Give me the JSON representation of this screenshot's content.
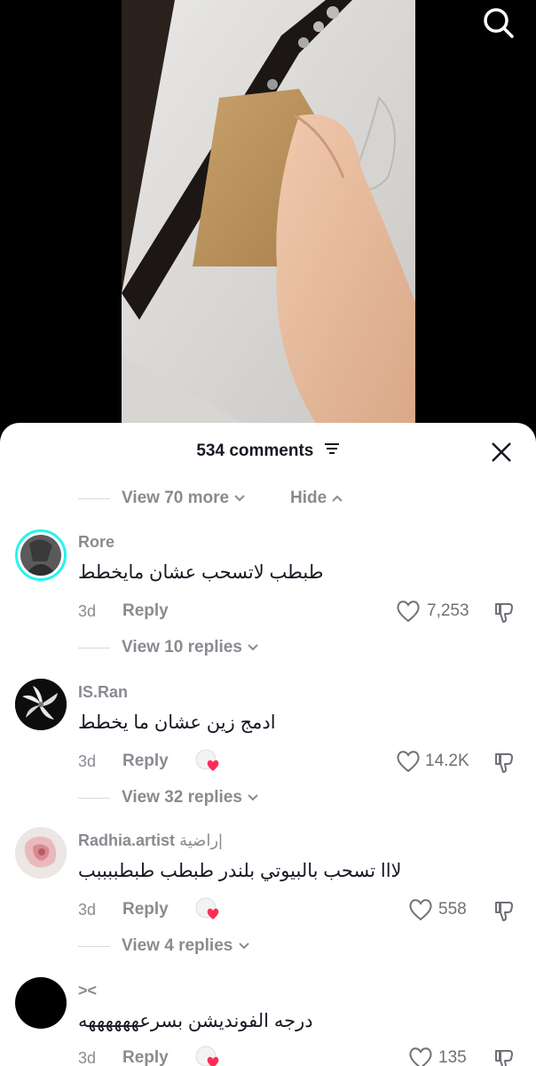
{
  "header": {
    "comments_count": "534 comments"
  },
  "top_more": {
    "view_more": "View 70 more",
    "hide": "Hide"
  },
  "comments": [
    {
      "username": "Rore",
      "text": "طبطب لاتسحب عشان مايخطط",
      "age": "3d",
      "reply": "Reply",
      "likes": "7,253",
      "view_replies": "View 10 replies",
      "creator_liked": false
    },
    {
      "username": "IS.Ran",
      "text": "ادمج زين عشان ما يخطط",
      "age": "3d",
      "reply": "Reply",
      "likes": "14.2K",
      "view_replies": "View 32 replies",
      "creator_liked": true
    },
    {
      "username": "Radhia.artist",
      "username_extra": "راضية|",
      "text": "لااا تسحب بالبيوتي بلندر طبطب طبطببببب",
      "age": "3d",
      "reply": "Reply",
      "likes": "558",
      "view_replies": "View 4 replies",
      "creator_liked": true
    },
    {
      "username": "><",
      "text": "درجه الفونديشن بسرعههههههه",
      "age": "3d",
      "reply": "Reply",
      "likes": "135",
      "creator_liked": true
    }
  ],
  "colors": {
    "text": "#161823",
    "muted": "#8a8b91",
    "heart_red": "#fe2c55",
    "avatar_ring": "#25f4ee"
  }
}
